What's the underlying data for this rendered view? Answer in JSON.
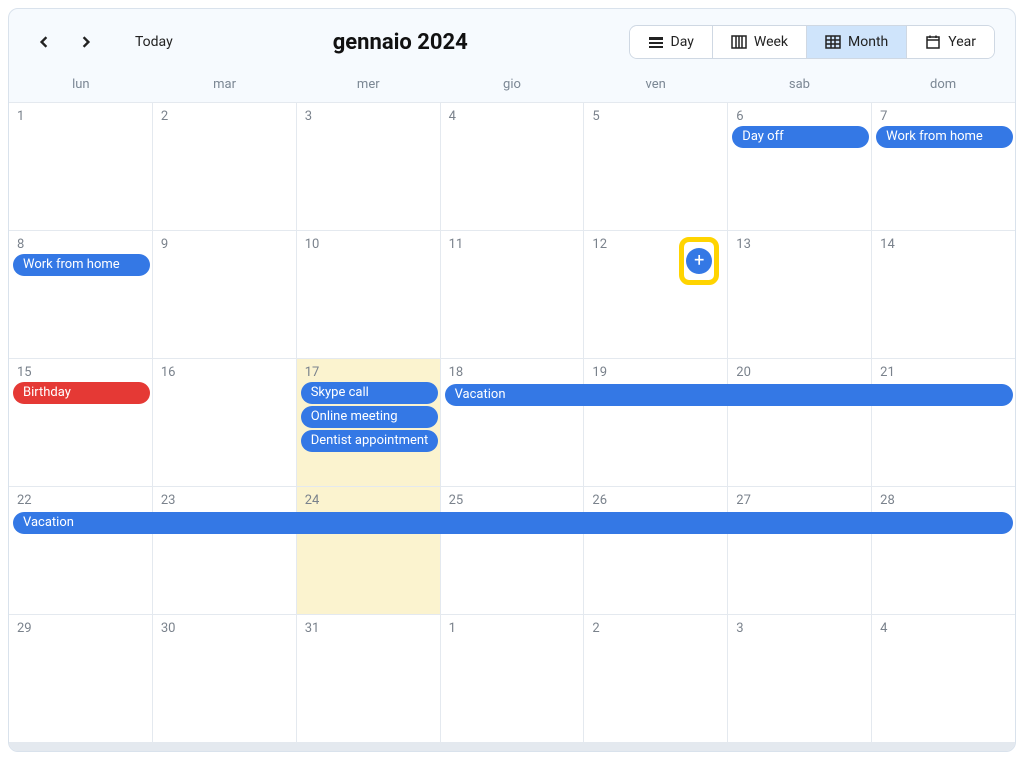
{
  "toolbar": {
    "today_label": "Today",
    "title": "gennaio 2024",
    "views": {
      "day": "Day",
      "week": "Week",
      "month": "Month",
      "year": "Year"
    },
    "active_view": "month"
  },
  "weekdays": [
    "lun",
    "mar",
    "mer",
    "gio",
    "ven",
    "sab",
    "dom"
  ],
  "weeks": [
    [
      {
        "num": "1",
        "events": []
      },
      {
        "num": "2",
        "events": []
      },
      {
        "num": "3",
        "events": []
      },
      {
        "num": "4",
        "events": []
      },
      {
        "num": "5",
        "events": []
      },
      {
        "num": "6",
        "events": [
          {
            "label": "Day off",
            "color": "blue",
            "span": 1
          }
        ]
      },
      {
        "num": "7",
        "events": [
          {
            "label": "Work from home",
            "color": "blue",
            "span": 1
          }
        ]
      }
    ],
    [
      {
        "num": "8",
        "events": [
          {
            "label": "Work from home",
            "color": "blue",
            "span": 1
          }
        ]
      },
      {
        "num": "9",
        "events": []
      },
      {
        "num": "10",
        "events": []
      },
      {
        "num": "11",
        "events": []
      },
      {
        "num": "12",
        "add_button": true,
        "events": []
      },
      {
        "num": "13",
        "events": []
      },
      {
        "num": "14",
        "events": []
      }
    ],
    [
      {
        "num": "15",
        "events": [
          {
            "label": "Birthday",
            "color": "red",
            "span": 1
          }
        ]
      },
      {
        "num": "16",
        "events": []
      },
      {
        "num": "17",
        "highlight": true,
        "events": [
          {
            "label": "Skype call",
            "color": "blue",
            "span": 1
          },
          {
            "label": "Online meeting",
            "color": "blue",
            "span": 1
          },
          {
            "label": "Dentist appointment",
            "color": "blue",
            "span": 1
          }
        ]
      },
      {
        "num": "18",
        "events": [
          {
            "label": "Vacation",
            "color": "blue",
            "span": 4
          }
        ]
      },
      {
        "num": "19",
        "events": []
      },
      {
        "num": "20",
        "events": []
      },
      {
        "num": "21",
        "events": []
      }
    ],
    [
      {
        "num": "22",
        "events": [
          {
            "label": "Vacation",
            "color": "blue",
            "span": 7
          }
        ]
      },
      {
        "num": "23",
        "events": []
      },
      {
        "num": "24",
        "highlight": true,
        "events": []
      },
      {
        "num": "25",
        "events": []
      },
      {
        "num": "26",
        "events": []
      },
      {
        "num": "27",
        "events": []
      },
      {
        "num": "28",
        "events": []
      }
    ],
    [
      {
        "num": "29",
        "events": []
      },
      {
        "num": "30",
        "events": []
      },
      {
        "num": "31",
        "events": []
      },
      {
        "num": "1",
        "events": []
      },
      {
        "num": "2",
        "events": []
      },
      {
        "num": "3",
        "events": []
      },
      {
        "num": "4",
        "events": []
      }
    ],
    [
      {
        "num": "",
        "events": []
      },
      {
        "num": "",
        "events": []
      },
      {
        "num": "",
        "events": []
      },
      {
        "num": "",
        "events": []
      },
      {
        "num": "",
        "events": []
      },
      {
        "num": "",
        "events": []
      },
      {
        "num": "",
        "events": []
      }
    ]
  ],
  "colors": {
    "blue": "#3478e5",
    "red": "#e53935",
    "highlight_yellow": "#fbf3cf",
    "fab_border": "#ffd400"
  }
}
